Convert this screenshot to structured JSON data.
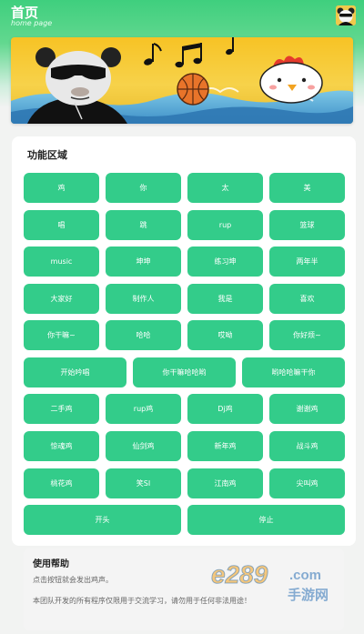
{
  "header": {
    "title": "首页",
    "subtitle": "home page",
    "avatar_icon": "panda-meme-avatar-icon"
  },
  "banner": {
    "image": "panda-meme-chicken-basketball-banner"
  },
  "functions": {
    "title": "功能区域",
    "rows": [
      [
        "鸡",
        "你",
        "太",
        "美"
      ],
      [
        "唱",
        "跳",
        "rup",
        "篮球"
      ],
      [
        "music",
        "坤坤",
        "练习坤",
        "两年半"
      ],
      [
        "大家好",
        "制作人",
        "我是",
        "喜欢"
      ],
      [
        "你干嘛~",
        "哈哈",
        "哎呦",
        "你好烦~"
      ],
      [
        "开始吟唱",
        "你干嘛哈哈哟",
        "哟哈哈嘛干你"
      ],
      [
        "二手鸡",
        "rup鸡",
        "Dj鸡",
        "谢谢鸡"
      ],
      [
        "惊魂鸡",
        "仙剑鸡",
        "新年鸡",
        "战斗鸡"
      ],
      [
        "桃花鸡",
        "笑SI",
        "江南鸡",
        "尖叫鸡"
      ]
    ],
    "controls": {
      "start": "开头",
      "stop": "停止"
    }
  },
  "help": {
    "title": "使用帮助",
    "line1": "点击按钮就会发出鸡声。",
    "line2": "本团队开发的所有程序仅限用于交流学习，请勿用于任何非法用途！"
  },
  "watermark": {
    "brand": "e289",
    "domain": ".com",
    "cn": "手游网"
  },
  "colors": {
    "accent": "#33cc8a",
    "header": "#3fcf7e"
  }
}
